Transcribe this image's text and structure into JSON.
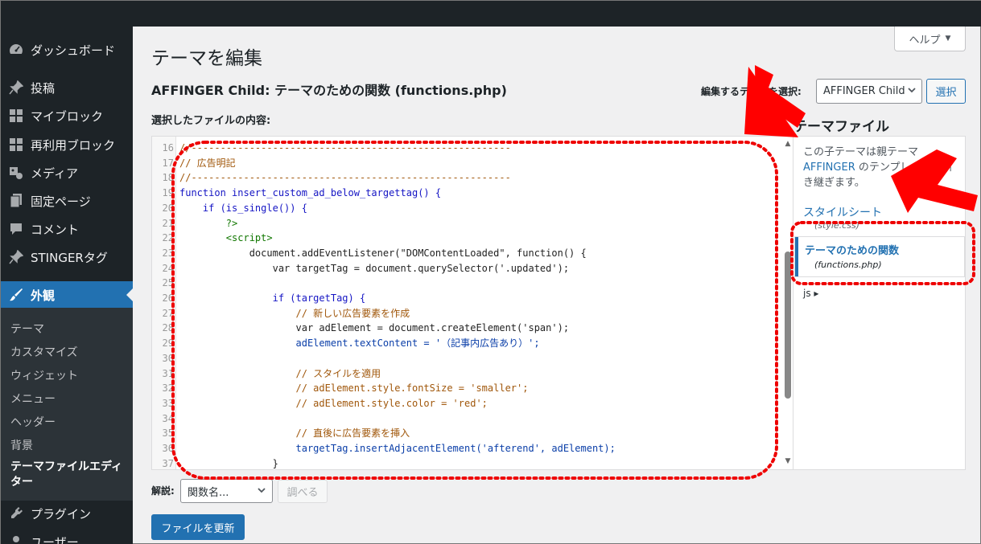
{
  "sidebar": {
    "items": [
      {
        "label": "ダッシュボード",
        "icon": "dashboard-icon"
      },
      {
        "label": "投稿",
        "icon": "pin-icon"
      },
      {
        "label": "マイブロック",
        "icon": "blocks-icon"
      },
      {
        "label": "再利用ブロック",
        "icon": "blocks-icon"
      },
      {
        "label": "メディア",
        "icon": "media-icon"
      },
      {
        "label": "固定ページ",
        "icon": "page-icon"
      },
      {
        "label": "コメント",
        "icon": "comment-icon"
      },
      {
        "label": "STINGERタグ",
        "icon": "pin-icon"
      },
      {
        "label": "外観",
        "icon": "brush-icon"
      }
    ],
    "submenu": [
      "テーマ",
      "カスタマイズ",
      "ウィジェット",
      "メニュー",
      "ヘッダー",
      "背景",
      "テーマファイルエディター"
    ],
    "after": [
      {
        "label": "プラグイン",
        "icon": "plugin-icon"
      },
      {
        "label": "ユーザー",
        "icon": "user-icon"
      }
    ]
  },
  "header": {
    "help": "ヘルプ",
    "title": "テーマを編集",
    "file_title": "AFFINGER Child: テーマのための関数 (functions.php)",
    "select_label": "編集するテーマを選択:",
    "theme_value": "AFFINGER Child",
    "select_button": "選択",
    "content_label": "選択したファイルの内容:"
  },
  "editor": {
    "lines": [
      {
        "n": "16",
        "text": "//-------------------------------------------------------",
        "cls": "c-comment"
      },
      {
        "n": "17",
        "text": "// 広告明記",
        "cls": "c-comment"
      },
      {
        "n": "18",
        "text": "//-------------------------------------------------------",
        "cls": "c-comment"
      },
      {
        "n": "19",
        "text": "function insert_custom_ad_below_targettag() {",
        "cls": "c-kw"
      },
      {
        "n": "20",
        "text": "    if (is_single()) {",
        "cls": "c-kw"
      },
      {
        "n": "21",
        "text": "        ?>",
        "cls": "c-tag"
      },
      {
        "n": "22",
        "text": "        <script>",
        "cls": "c-tag"
      },
      {
        "n": "23",
        "text": "            document.addEventListener(\"DOMContentLoaded\", function() {",
        "cls": "c-plain"
      },
      {
        "n": "24",
        "text": "                var targetTag = document.querySelector('.updated');",
        "cls": "c-plain"
      },
      {
        "n": "25",
        "text": "",
        "cls": "c-plain"
      },
      {
        "n": "26",
        "text": "                if (targetTag) {",
        "cls": "c-kw"
      },
      {
        "n": "27",
        "text": "                    // 新しい広告要素を作成",
        "cls": "c-comment"
      },
      {
        "n": "28",
        "text": "                    var adElement = document.createElement('span');",
        "cls": "c-plain"
      },
      {
        "n": "29",
        "text": "                    adElement.textContent = '（記事内広告あり）';",
        "cls": "c-def"
      },
      {
        "n": "30",
        "text": "",
        "cls": "c-plain"
      },
      {
        "n": "31",
        "text": "                    // スタイルを適用",
        "cls": "c-comment"
      },
      {
        "n": "32",
        "text": "                    // adElement.style.fontSize = 'smaller';",
        "cls": "c-comment"
      },
      {
        "n": "33",
        "text": "                    // adElement.style.color = 'red';",
        "cls": "c-comment"
      },
      {
        "n": "34",
        "text": "",
        "cls": "c-plain"
      },
      {
        "n": "35",
        "text": "                    // 直後に広告要素を挿入",
        "cls": "c-comment"
      },
      {
        "n": "36",
        "text": "                    targetTag.insertAdjacentElement('afterend', adElement);",
        "cls": "c-def"
      },
      {
        "n": "37",
        "text": "                }",
        "cls": "c-plain"
      }
    ]
  },
  "files": {
    "heading": "テーマファイル",
    "desc_pre": "この子テーマは親テーマ",
    "desc_link": "AFFINGER",
    "desc_post": " のテンプレートを引き継ぎます。",
    "stylesheet": "スタイルシート",
    "stylesheet_file": "(style.css)",
    "current_name": "テーマのための関数",
    "current_file": "(functions.php)",
    "folder": "js ▸"
  },
  "footer": {
    "doc_label": "解説:",
    "doc_value": "関数名...",
    "lookup": "調べる",
    "update": "ファイルを更新"
  },
  "colors": {
    "accent": "#2271b1",
    "sidebar_bg": "#1d2327",
    "annotation": "#ff0000"
  }
}
